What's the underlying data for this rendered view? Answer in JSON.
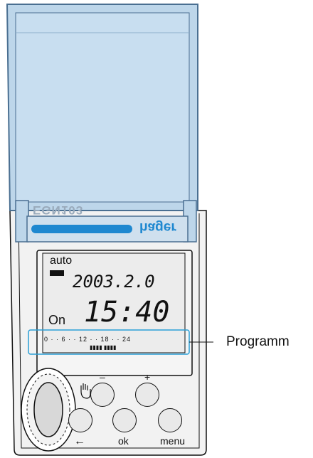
{
  "device": {
    "model": "EGN103",
    "brand": "hager"
  },
  "display": {
    "mode": "auto",
    "date": "2003.2.0",
    "time": "15:40",
    "state": "On",
    "scale": "0 · · 6 · · 12 · · 18 · · 24",
    "program_bars": "▮▮▮▮ ▮▮▮▮"
  },
  "buttons": {
    "minus_label": "–",
    "plus_label": "+",
    "ok_label": "ok",
    "menu_label": "menu",
    "back_label": "←"
  },
  "callout": {
    "label": "Programm"
  },
  "colors": {
    "lid": "#bdd6ea",
    "lid_border": "#4a6f91",
    "brand_bar": "#1e88d0",
    "callout": "#2a9fd6"
  }
}
